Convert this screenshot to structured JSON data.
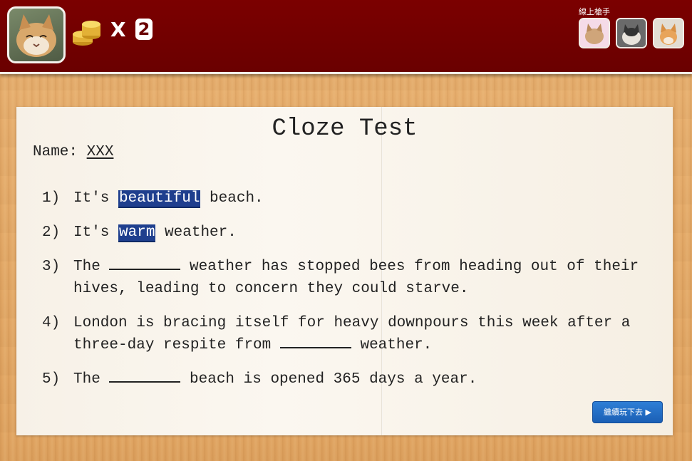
{
  "header": {
    "multiplier_symbol": "X",
    "coin_count": "2",
    "online_label": "線上槍手",
    "players": [
      "player-1",
      "player-2",
      "player-3"
    ]
  },
  "paper": {
    "title": "Cloze Test",
    "name_label": "Name:",
    "name_value": "XXX",
    "questions": [
      {
        "num": "1)",
        "pre": "It's ",
        "answer": "beautiful",
        "post": " beach."
      },
      {
        "num": "2)",
        "pre": "It's ",
        "answer": "warm",
        "post": " weather."
      },
      {
        "num": "3)",
        "pre": "The ",
        "post": " weather has stopped bees from heading out of their hives, leading to concern they could starve."
      },
      {
        "num": "4)",
        "pre": "London is bracing itself for heavy downpours this week after a three-day respite from ",
        "post": " weather."
      },
      {
        "num": "5)",
        "pre": "The ",
        "post": " beach is opened 365 days a year."
      }
    ],
    "next_button": "繼續玩下去 ▶"
  },
  "colors": {
    "header_bg": "#6a0000",
    "highlight": "#1f3f8e",
    "button": "#1b5fb5"
  }
}
